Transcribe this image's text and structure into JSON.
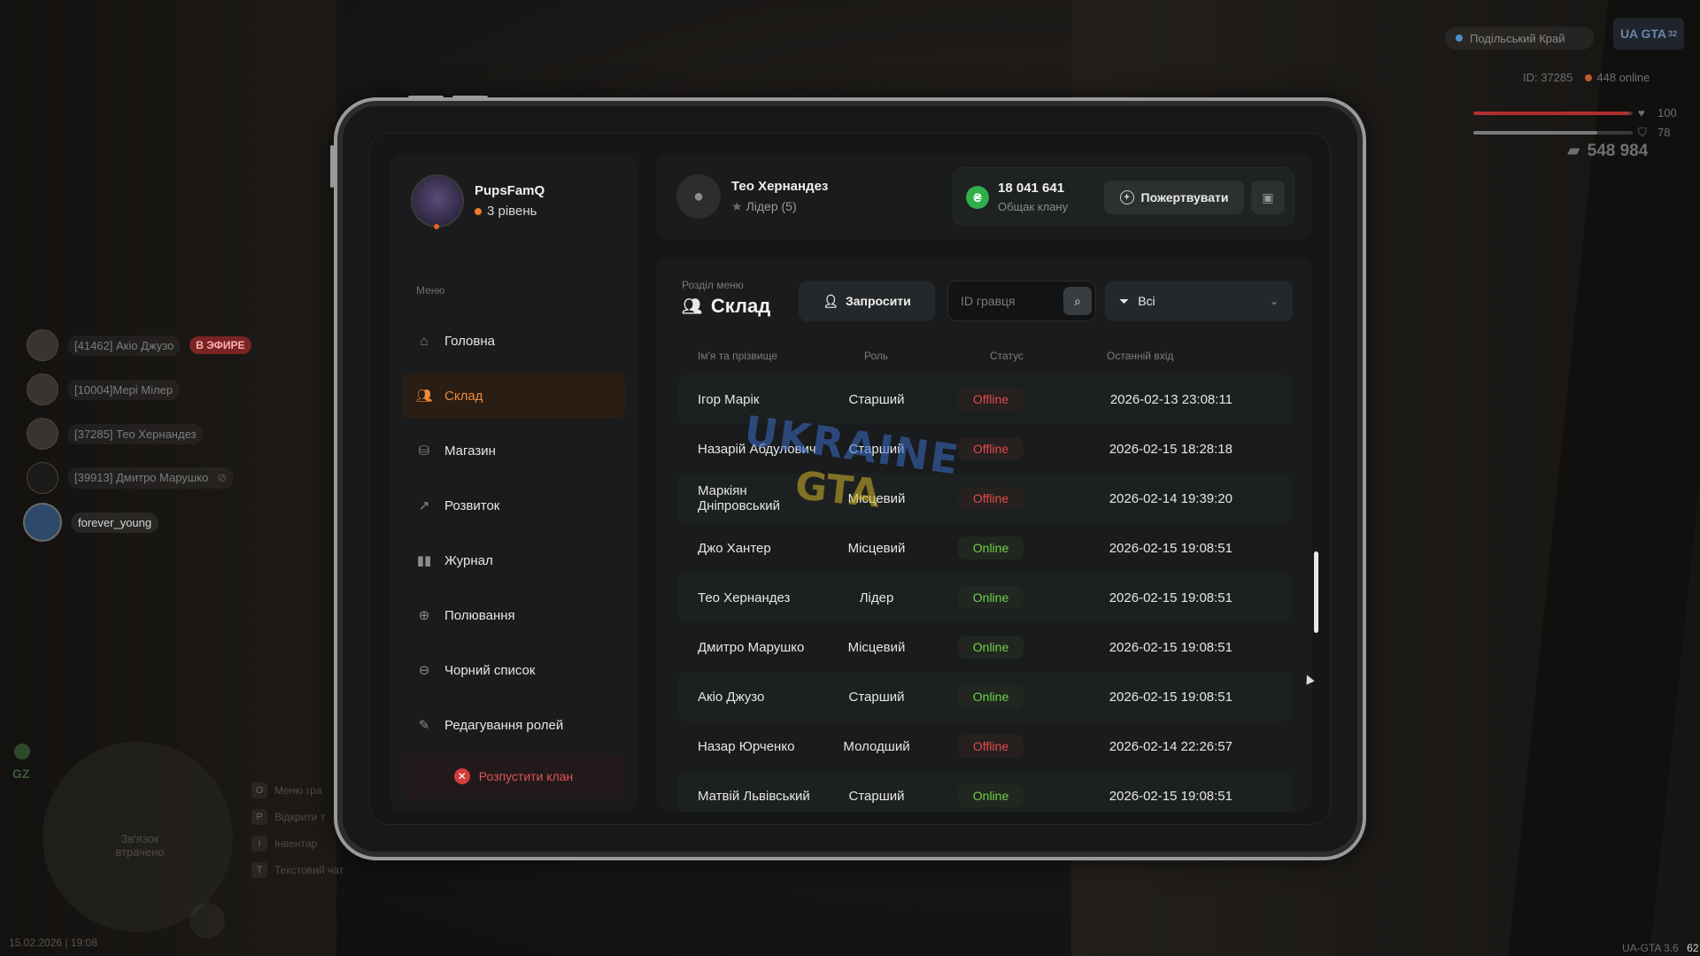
{
  "hud": {
    "location": "Подільський Край",
    "logo": "UA GTA",
    "logo_badge": "32",
    "player_id": "ID: 37285",
    "online": "448 online",
    "health": "100",
    "health_fraction": 0.98,
    "armor": "78",
    "armor_fraction": 0.78,
    "money": "548 984",
    "datetime": "15.02.2026 | 19:08",
    "version": "UA-GTA 3.6",
    "version_suffix": "62"
  },
  "voice_list": [
    {
      "name": "[41462] Акіо Джузо",
      "badge": "В ЭФИРЕ"
    },
    {
      "name": "[10004]Мері Мілер"
    },
    {
      "name": "[37285] Тео Хернандез"
    },
    {
      "name": "[39913] Дмитро Марушко",
      "muted": true
    },
    {
      "name": "forever_young",
      "active": true
    }
  ],
  "minimap": {
    "zone": "GZ",
    "lost_text": "Зв'язок втрачено"
  },
  "hints": [
    {
      "key": "O",
      "label": "Меню гра"
    },
    {
      "key": "P",
      "label": "Відкрити т"
    },
    {
      "key": "I",
      "label": "Інвентар"
    },
    {
      "key": "T",
      "label": "Текстовий чат"
    }
  ],
  "sidebar": {
    "username": "PupsFamQ",
    "level": "3 рівень",
    "menu_caption": "Меню",
    "items": [
      {
        "label": "Головна",
        "icon": "home-icon"
      },
      {
        "label": "Склад",
        "icon": "members-icon",
        "active": true
      },
      {
        "label": "Магазин",
        "icon": "shop-icon"
      },
      {
        "label": "Розвиток",
        "icon": "growth-chart-icon"
      },
      {
        "label": "Журнал",
        "icon": "journal-icon"
      },
      {
        "label": "Полювання",
        "icon": "crosshair-icon"
      },
      {
        "label": "Чорний список",
        "icon": "blocked-icon"
      },
      {
        "label": "Редагування ролей",
        "icon": "user-edit-icon"
      }
    ],
    "disband_label": "Розпустити клан"
  },
  "header": {
    "leader_name": "Тео Хернандез",
    "leader_role": "Лідер (5)",
    "bank_amount": "18 041 641",
    "bank_label": "Общак клану",
    "donate_label": "Пожертвувати"
  },
  "roster": {
    "section_caption": "Розділ меню",
    "section_title": "Склад",
    "invite_label": "Запросити",
    "search_placeholder": "ID гравця",
    "filter_value": "Всі",
    "columns": {
      "name": "Ім'я та прізвище",
      "role": "Роль",
      "status": "Статус",
      "last": "Останній вхід"
    },
    "rows": [
      {
        "name": "Ігор Марік",
        "role": "Старший",
        "status": "Offline",
        "last": "2026-02-13 23:08:11"
      },
      {
        "name": "Назарій Абдулович",
        "role": "Старший",
        "status": "Offline",
        "last": "2026-02-15 18:28:18"
      },
      {
        "name": "Маркіян Дніпровський",
        "role": "Місцевий",
        "status": "Offline",
        "last": "2026-02-14 19:39:20"
      },
      {
        "name": "Джо Хантер",
        "role": "Місцевий",
        "status": "Online",
        "last": "2026-02-15 19:08:51"
      },
      {
        "name": "Тео Хернандез",
        "role": "Лідер",
        "status": "Online",
        "last": "2026-02-15 19:08:51"
      },
      {
        "name": "Дмитро Марушко",
        "role": "Місцевий",
        "status": "Online",
        "last": "2026-02-15 19:08:51"
      },
      {
        "name": "Акіо Джузо",
        "role": "Старший",
        "status": "Online",
        "last": "2026-02-15 19:08:51"
      },
      {
        "name": "Назар Юрченко",
        "role": "Молодший",
        "status": "Offline",
        "last": "2026-02-14 22:26:57"
      },
      {
        "name": "Матвій Львівський",
        "role": "Старший",
        "status": "Online",
        "last": "2026-02-15 19:08:51"
      }
    ]
  },
  "watermark": {
    "top": "UKRAINE",
    "bottom": "GTA"
  },
  "colors": {
    "accent": "#f08a3a",
    "online": "#6fd24c",
    "offline": "#e04b4b",
    "bank": "#2fae4a",
    "danger": "#e05656"
  }
}
